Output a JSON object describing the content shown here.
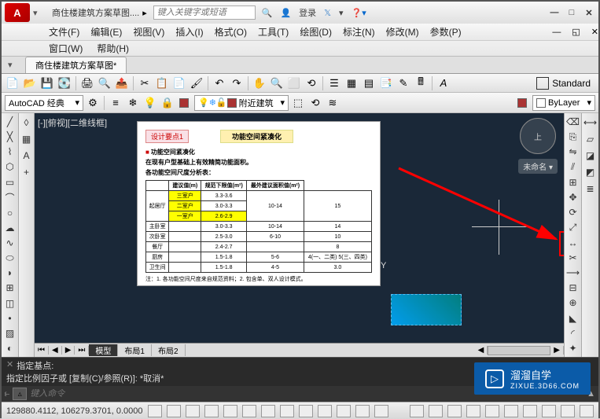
{
  "title": {
    "doc": "商住楼建筑方案草图...."
  },
  "search": {
    "placeholder": "键入关键字或短语"
  },
  "login": "登录",
  "menu": [
    "文件(F)",
    "编辑(E)",
    "视图(V)",
    "插入(I)",
    "格式(O)",
    "工具(T)",
    "绘图(D)",
    "标注(N)",
    "修改(M)",
    "参数(P)"
  ],
  "menu2": [
    "窗口(W)",
    "帮助(H)"
  ],
  "file_tab": "商住楼建筑方案草图*",
  "standard_label": "Standard",
  "style_combo": "AutoCAD 经典",
  "layer_combo": "附近建筑",
  "bylayer": "ByLayer",
  "viewport": "[-][俯视][二维线框]",
  "viewcube": "上",
  "unnamed": "未命名 ▾",
  "y_marker": "Y",
  "model_tabs": {
    "nav": [
      "⏮",
      "◀",
      "▶",
      "⏭"
    ],
    "tabs": [
      "模型",
      "布局1",
      "布局2"
    ]
  },
  "cmd": {
    "line1": "指定基点:",
    "line2": "指定比例因子或 [复制(C)/参照(R)]: *取消*",
    "placeholder": "键入命令"
  },
  "status": {
    "coords": "129880.4112, 106279.3701, 0.0000"
  },
  "watermark": {
    "brand": "溜溜自学",
    "sub": "ZIXUE.3D66.COM"
  },
  "embedded": {
    "chip1": "设计要点1",
    "chip2": "功能空间紧凑化",
    "h1": "功能空间紧凑化",
    "h2": "在现有户型基础上有效精简功能面积。",
    "h3": "各功能空间尺度分析表：",
    "headers": [
      "",
      "建议值(m)",
      "规范下限值(m²)",
      "最外建议面积值(m²)"
    ],
    "rows": [
      [
        "起居厅",
        "三室户",
        "3.3-3.6",
        "10-14",
        "15"
      ],
      [
        "",
        "二室户",
        "3.0-3.3",
        "",
        ""
      ],
      [
        "",
        "一室户",
        "2.6-2.9",
        "",
        ""
      ],
      [
        "主卧室",
        "",
        "3.0-3.3",
        "10-14",
        "14"
      ],
      [
        "次卧室",
        "",
        "2.5-3.0",
        "6-10",
        "10"
      ],
      [
        "餐厅",
        "",
        "2.4-2.7",
        "",
        "8"
      ],
      [
        "厨房",
        "",
        "1.5-1.8",
        "5-6",
        "4(一、二类)\n5(三、四类)"
      ],
      [
        "卫生间",
        "",
        "1.5-1.8",
        "4-5",
        "3.0"
      ]
    ],
    "notes": "注：1. 各功能空间尺度来自规范资料；2. 包含单、双人设计模式。"
  }
}
